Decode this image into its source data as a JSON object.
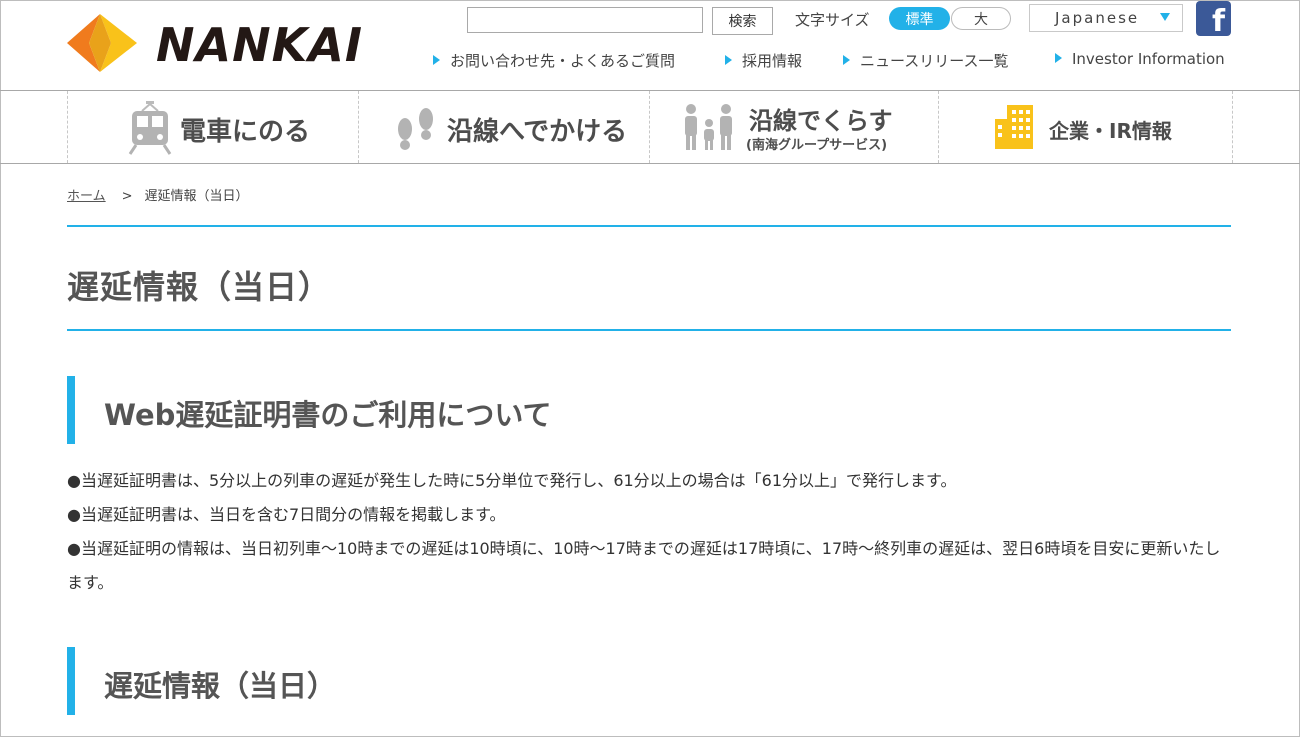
{
  "brand": {
    "name": "NANKAI",
    "colors": {
      "orange": "#f07b1d",
      "yellow": "#f9c21a",
      "blue": "#22b1e8",
      "fb": "#3b5998"
    }
  },
  "header": {
    "search_placeholder": "",
    "search_button": "検索",
    "fontsize_label": "文字サイズ",
    "fontsize_standard": "標準",
    "fontsize_large": "大",
    "language": "Japanese",
    "facebook_glyph": "f",
    "links": [
      "お問い合わせ先・よくあるご質問",
      "採用情報",
      "ニュースリリース一覧",
      "Investor Information"
    ]
  },
  "nav": [
    {
      "icon": "train-icon",
      "label": "電車にのる"
    },
    {
      "icon": "footprints-icon",
      "label": "沿線へでかける"
    },
    {
      "icon": "family-icon",
      "label": "沿線でくらす",
      "sublabel": "(南海グループサービス)"
    },
    {
      "icon": "building-icon",
      "label": "企業・IR情報"
    }
  ],
  "breadcrumb": {
    "home": "ホーム",
    "separator": ">",
    "current": "遅延情報（当日）"
  },
  "page_title": "遅延情報（当日）",
  "sections": [
    {
      "heading": "Web遅延証明書のご利用について"
    },
    {
      "heading": "遅延情報（当日）"
    }
  ],
  "notes": [
    "●当遅延証明書は、5分以上の列車の遅延が発生した時に5分単位で発行し、61分以上の場合は「61分以上」で発行します。",
    "●当遅延証明書は、当日を含む7日間分の情報を掲載します。",
    "●当遅延証明の情報は、当日初列車～10時までの遅延は10時頃に、10時～17時までの遅延は17時頃に、17時～終列車の遅延は、翌日6時頃を目安に更新いたします。"
  ]
}
